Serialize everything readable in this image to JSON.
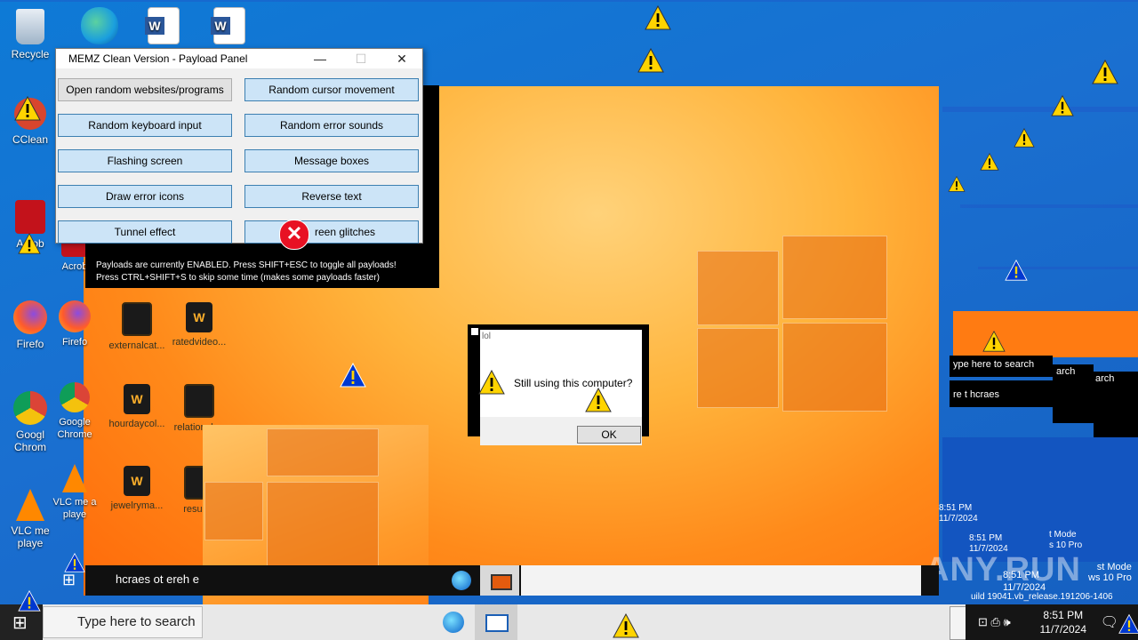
{
  "desktop": {
    "icons": [
      {
        "label": "Recycle",
        "icon": "recycle-bin-icon"
      },
      {
        "label": "CClean",
        "icon": "ccleaner-icon"
      },
      {
        "label": "Acrob",
        "icon": "acrobat-icon"
      },
      {
        "label": "Firefo",
        "icon": "firefox-icon"
      },
      {
        "label": "Googl Chrom",
        "icon": "chrome-icon"
      },
      {
        "label": "VLC me playe",
        "icon": "vlc-icon"
      }
    ],
    "second_icons": [
      {
        "label": "Acrob",
        "icon": "acrobat-icon"
      },
      {
        "label": "Firefo",
        "icon": "firefox-icon"
      },
      {
        "label": "Google Chrome",
        "icon": "chrome-icon"
      },
      {
        "label": "VLC me a playe",
        "icon": "vlc-icon"
      }
    ],
    "files": [
      {
        "label": "externalcat...",
        "icon": "image-file-icon"
      },
      {
        "label": "ratedvideo...",
        "icon": "word-file-icon"
      },
      {
        "label": "hourdaycol...",
        "icon": "word-file-icon"
      },
      {
        "label": "relationsh...",
        "icon": "image-file-icon"
      },
      {
        "label": "jewelryma...",
        "icon": "word-file-icon"
      },
      {
        "label": "result.c",
        "icon": "image-file-icon"
      }
    ]
  },
  "panel": {
    "title": "MEMZ Clean Version - Payload Panel",
    "minimize": "—",
    "maximize": "☐",
    "close": "✕",
    "buttons": [
      "Open random websites/programs",
      "Random cursor movement",
      "Random keyboard input",
      "Random error sounds",
      "Flashing screen",
      "Message boxes",
      "Draw error icons",
      "Reverse text",
      "Tunnel effect",
      "reen glitches"
    ]
  },
  "black_panel": {
    "line1": "Payloads are currently ENABLED. Press SHIFT+ESC to toggle all payloads!",
    "line2": "Press CTRL+SHIFT+S to skip some time (makes some payloads faster)"
  },
  "dialog": {
    "title": "lol",
    "message": "Still using this computer?",
    "ok_label": "OK"
  },
  "taskbar": {
    "search_placeholder": "Type here to search",
    "time": "8:51 PM",
    "date": "11/7/2024",
    "reversed_search": "hcraes ot ereh e"
  },
  "glitch": {
    "search1": "ype here to search",
    "search2": "arch",
    "search3": "arch",
    "reversed": "re t hcraes",
    "mode_lines": [
      "t Mode",
      "s 10 Pro",
      "uild 19041.vb_release.191206-1406"
    ],
    "mode_lines2": [
      "st Mode",
      "ws 10 Pro",
      "ild 19041.vb_release.191206-1406"
    ],
    "small_time": "8:51 PM",
    "small_date": "11/7/2024",
    "watermark": "ANY.RUN"
  },
  "colors": {
    "desktop_blue": "#1769c9",
    "button_blue": "#cce4f7",
    "warning_yellow": "#ffd400",
    "error_red": "#e81123",
    "wallpaper_orange": "#ff8a1a"
  }
}
